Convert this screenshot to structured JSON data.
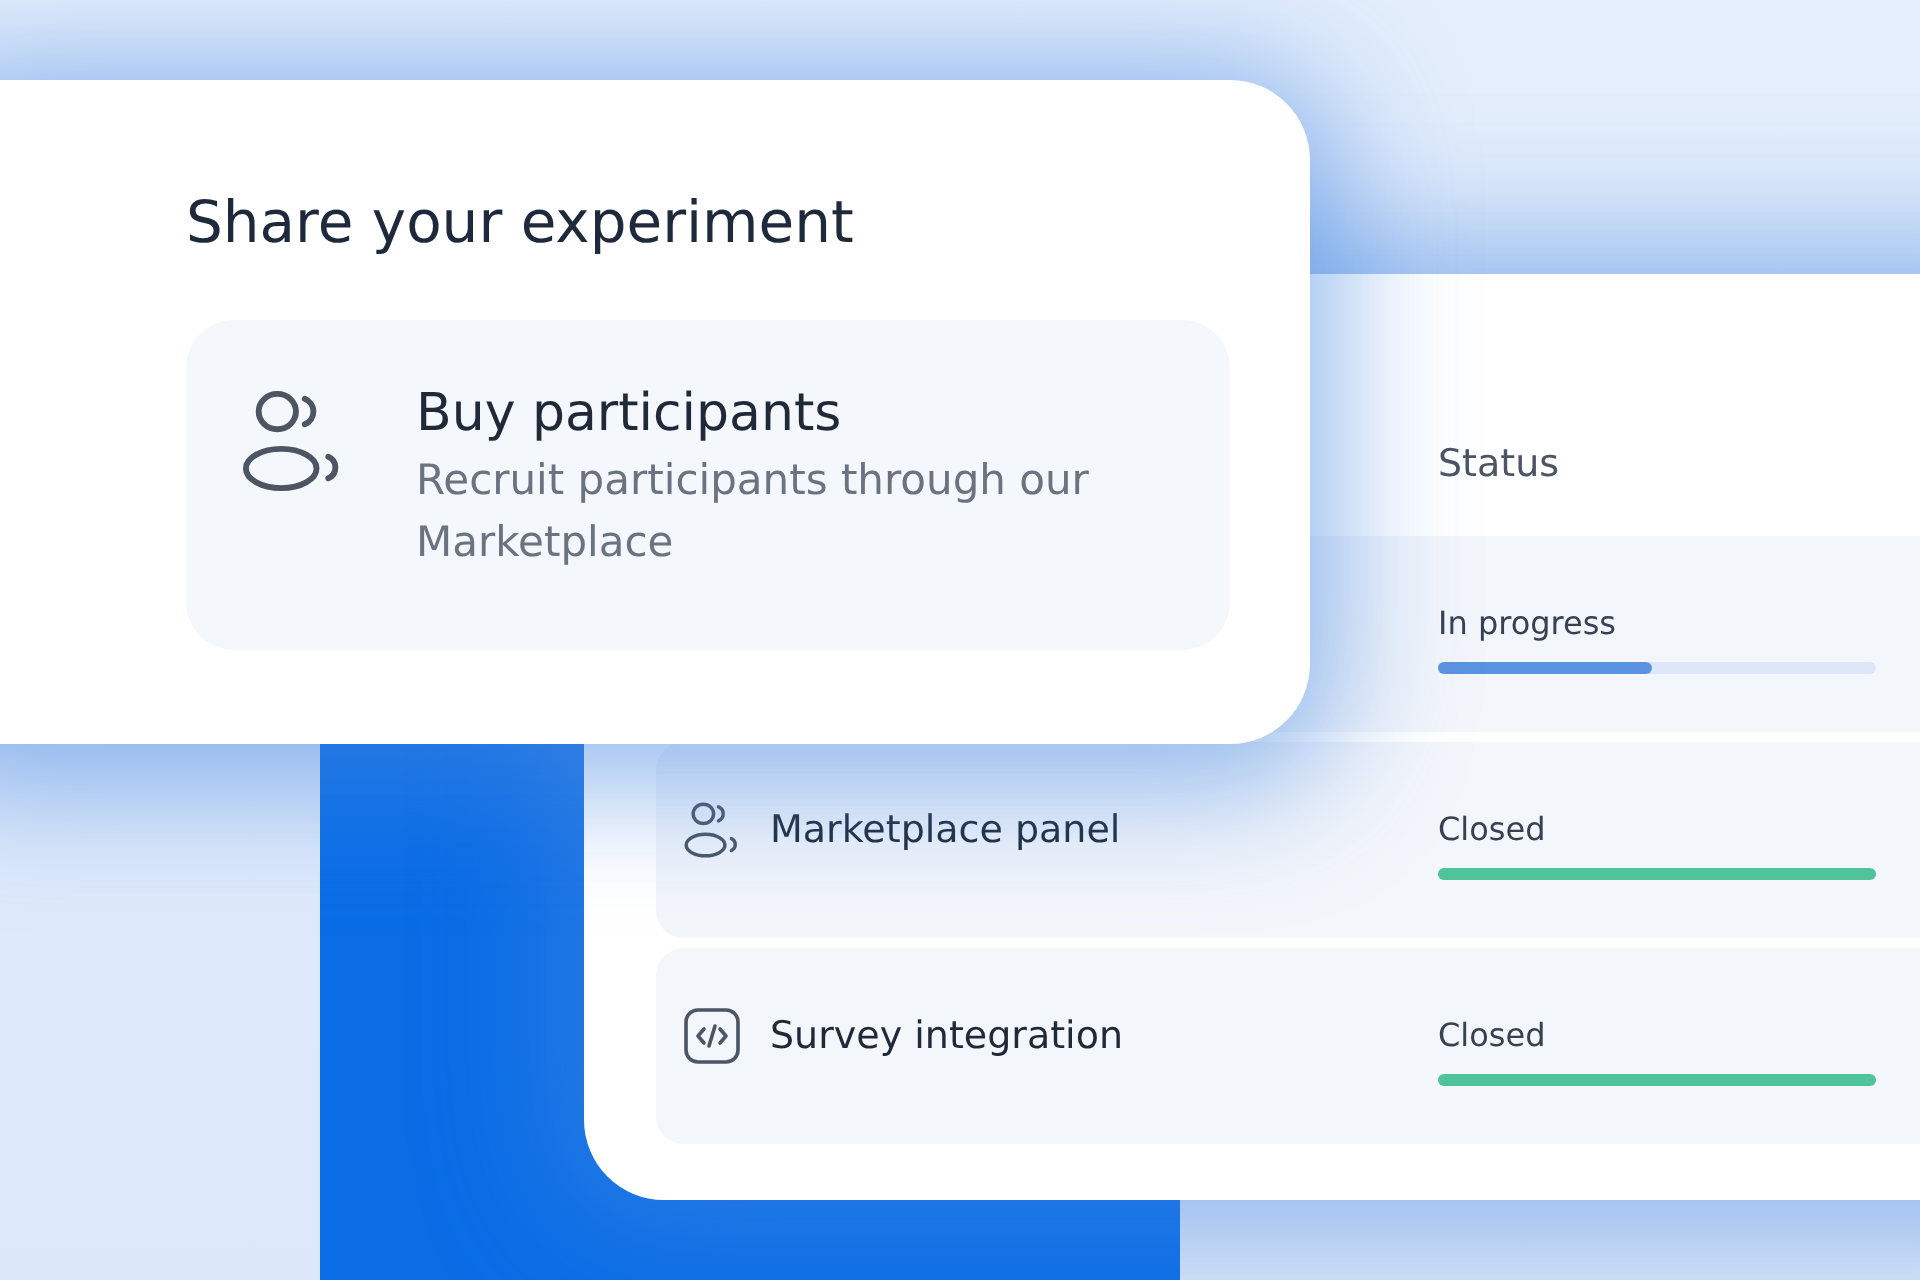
{
  "card": {
    "title": "Share your experiment",
    "option": {
      "title": "Buy participants",
      "description": "Recruit participants through our Marketplace"
    }
  },
  "table": {
    "status_heading": "Status",
    "rows": [
      {
        "status": "In progress",
        "level": 0.49,
        "color": "#5b93e0"
      },
      {
        "kind": "panel",
        "name": "Marketplace panel",
        "status": "Closed",
        "level": 1,
        "color": "#4fc39a"
      },
      {
        "kind": "integration",
        "name": "Survey integration",
        "status": "Closed",
        "level": 1,
        "color": "#4fc39a"
      }
    ]
  }
}
